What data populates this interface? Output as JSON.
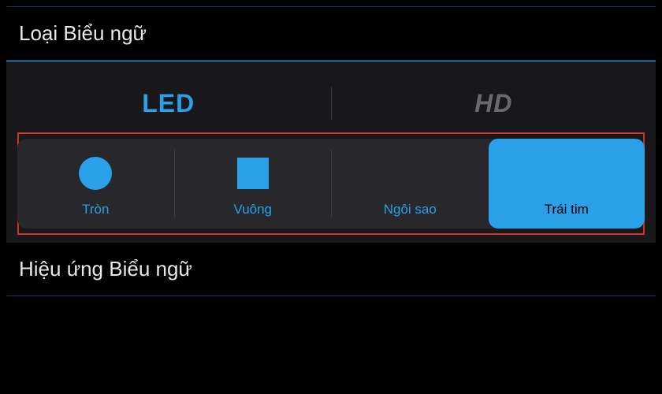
{
  "sections": {
    "banner_type_title": "Loại Biểu ngữ",
    "banner_effect_title": "Hiệu ứng Biểu ngữ"
  },
  "tabs": {
    "led": "LED",
    "hd": "HD",
    "active": "led"
  },
  "shapes": [
    {
      "id": "circle",
      "label": "Tròn",
      "selected": false
    },
    {
      "id": "square",
      "label": "Vuông",
      "selected": false
    },
    {
      "id": "star",
      "label": "Ngôi sao",
      "selected": false
    },
    {
      "id": "heart",
      "label": "Trái tim",
      "selected": true
    }
  ],
  "colors": {
    "accent": "#29a0e8",
    "highlight_border": "#d43030",
    "bg_dark": "#000",
    "bg_panel": "#18181a",
    "bg_row": "#28282c"
  }
}
